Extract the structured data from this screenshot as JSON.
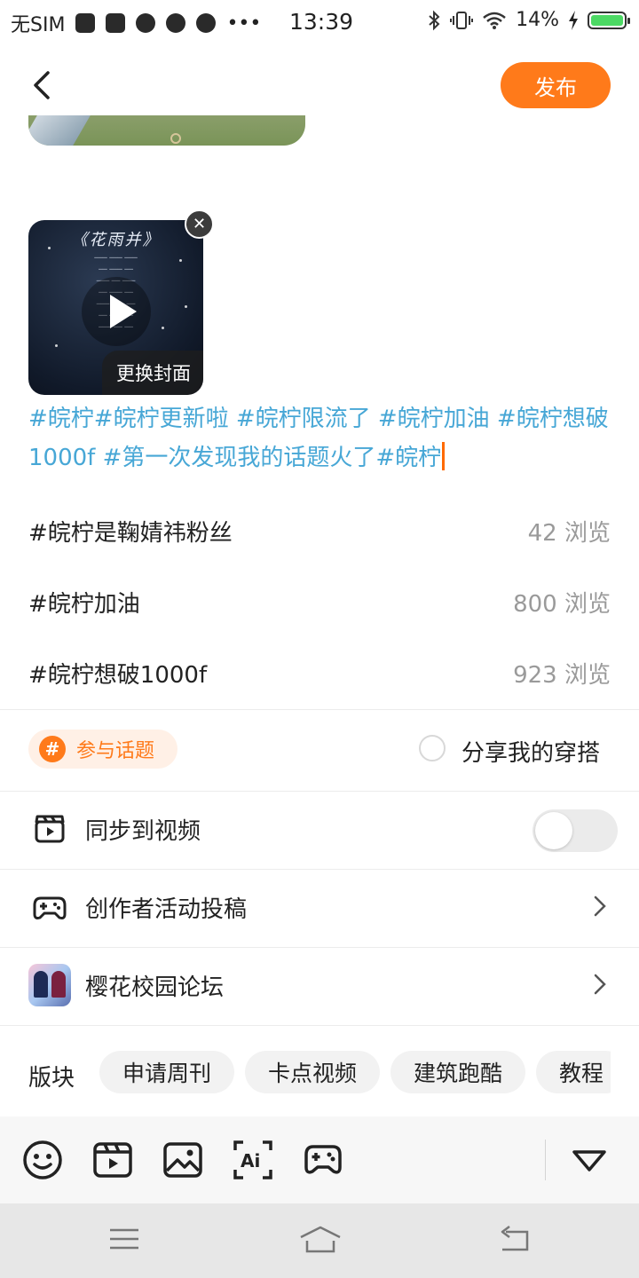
{
  "status_bar": {
    "carrier": "无SIM",
    "time": "13:39",
    "battery": "14%",
    "icons": [
      "mail-icon",
      "mail-icon",
      "cat-app-icon",
      "palette-icon",
      "play-icon",
      "more-dots-icon",
      "bluetooth-icon",
      "vibrate-icon",
      "wifi-icon",
      "battery-icon"
    ]
  },
  "header": {
    "back_icon": "chevron-left-icon",
    "publish_label": "发布"
  },
  "video": {
    "thumb_title": "《花雨并》",
    "cover_label": "更换封面",
    "remove_icon": "close-icon"
  },
  "post": {
    "text": "#皖柠#皖柠更新啦 #皖柠限流了 #皖柠加油 #皖柠想破1000f #第一次发现我的话题火了#皖柠"
  },
  "suggestions": [
    {
      "tag": "#皖柠是鞠婧祎粉丝",
      "views": "42 浏览"
    },
    {
      "tag": "#皖柠加油",
      "views": "800 浏览"
    },
    {
      "tag": "#皖柠想破1000f",
      "views": "923 浏览"
    }
  ],
  "topic": {
    "badge": "#",
    "label": "参与话题"
  },
  "outfit": {
    "label": "分享我的穿搭"
  },
  "rows": {
    "sync_video": "同步到视频",
    "creator_submit": "创作者活动投稿",
    "forum": "樱花校园论坛"
  },
  "sections": {
    "label": "版块",
    "chips": [
      "申请周刊",
      "卡点视频",
      "建筑跑酷",
      "教程"
    ]
  },
  "toolbar": {
    "icons": [
      "emoji-icon",
      "video-clip-icon",
      "image-icon",
      "ai-text-icon",
      "gamepad-icon",
      "collapse-down-icon"
    ]
  },
  "navbar": {
    "icons": [
      "menu-icon",
      "home-icon",
      "back-icon"
    ]
  },
  "colors": {
    "accent": "#ff7a1a",
    "topic_text": "#47a7d6",
    "cursor": "#ff6a00"
  }
}
